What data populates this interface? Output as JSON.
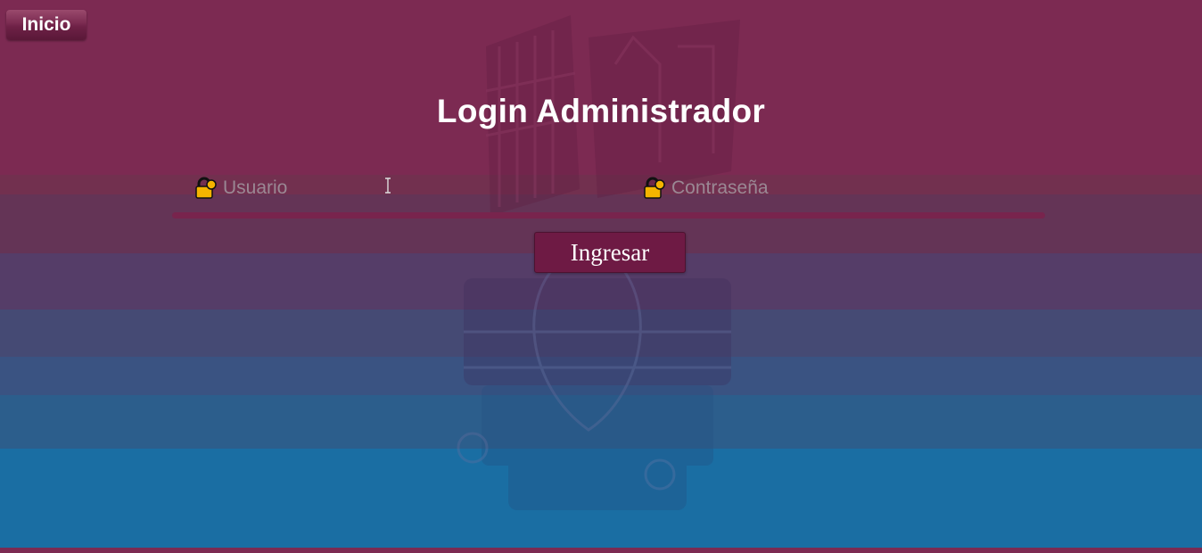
{
  "nav": {
    "home_label": "Inicio"
  },
  "login": {
    "title": "Login  Administrador",
    "user_placeholder": "Usuario",
    "password_placeholder": "Contraseña",
    "submit_label": "Ingresar"
  },
  "colors": {
    "brand_maroon": "#7c2a52",
    "button": "#6e1a44",
    "bottom_blue": "#1a6ea3"
  },
  "icons": [
    "lock-icon",
    "text-cursor-icon",
    "institution-logo"
  ]
}
